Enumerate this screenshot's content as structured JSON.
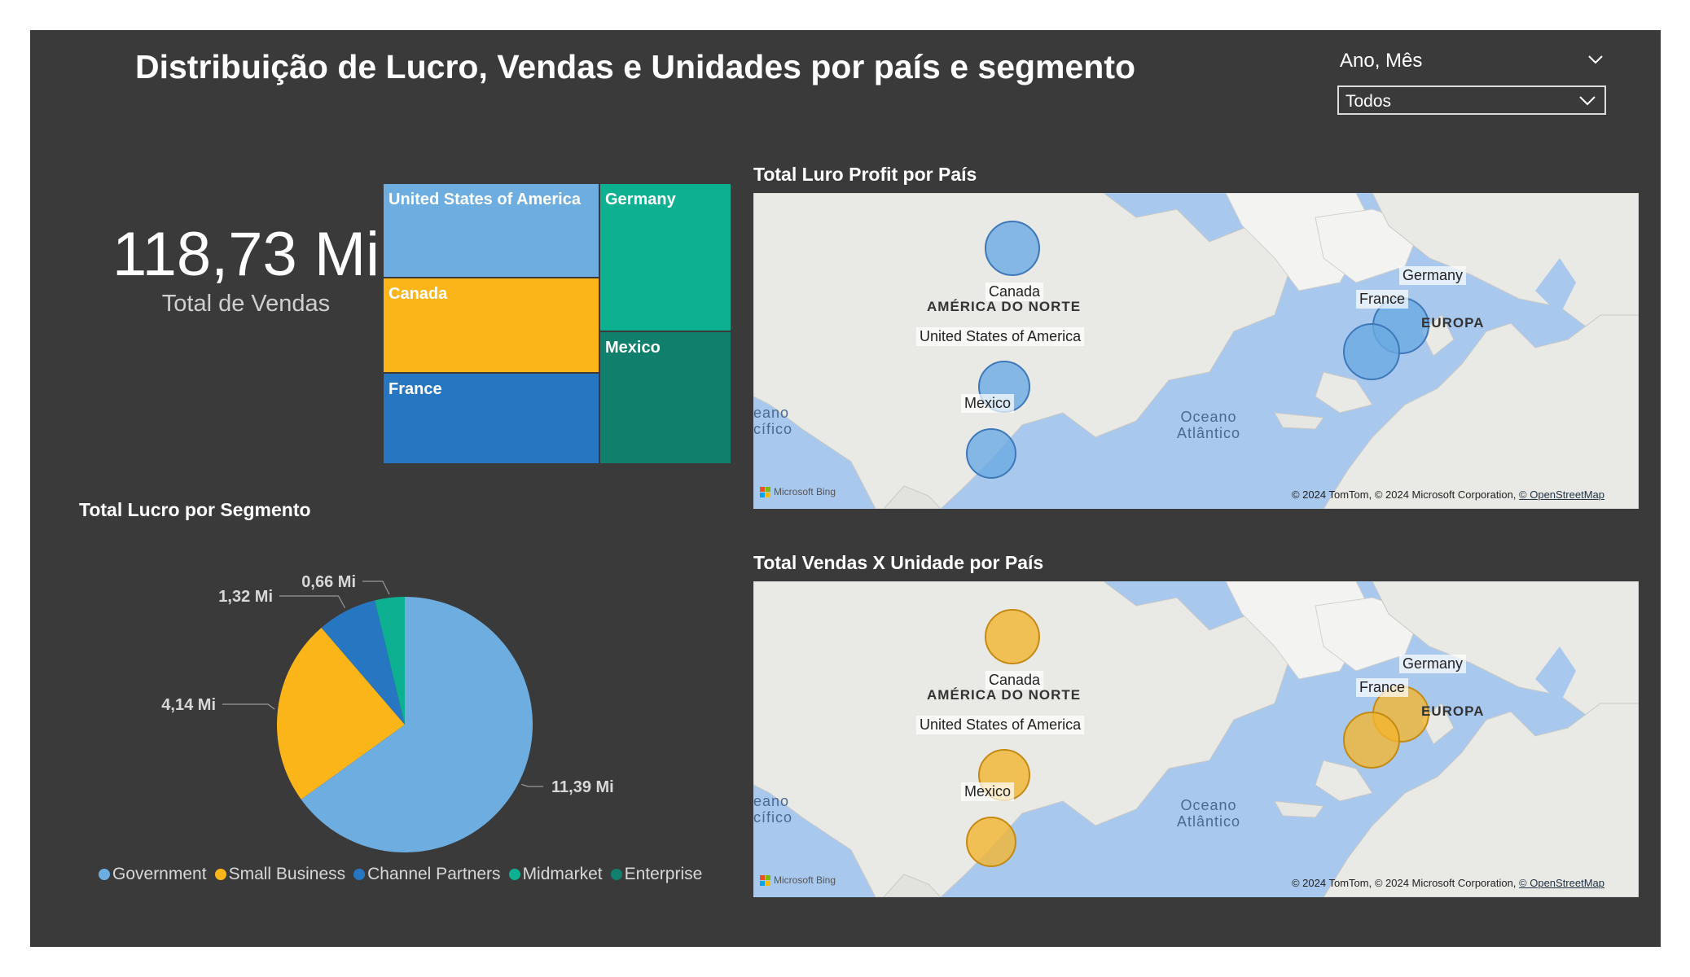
{
  "title": "Distribuição de Lucro, Vendas e Unidades por país e segmento",
  "slicer": {
    "label": "Ano, Mês",
    "value": "Todos"
  },
  "kpi": {
    "value": "118,73 Mi",
    "label": "Total de Vendas"
  },
  "treemap": {
    "tiles": [
      {
        "name": "United States of America",
        "color": "#6daddf"
      },
      {
        "name": "Canada",
        "color": "#fbb519"
      },
      {
        "name": "France",
        "color": "#2776c1"
      },
      {
        "name": "Germany",
        "color": "#0eb092"
      },
      {
        "name": "Mexico",
        "color": "#10806c"
      }
    ]
  },
  "map_profit": {
    "title": "Total Luro Profit por País",
    "bubble_color": "#6aaae2",
    "labels": {
      "canada": "Canada",
      "usa": "United States of America",
      "mexico": "Mexico",
      "germany": "Germany",
      "france": "France"
    },
    "geo": {
      "north_america": "AMÉRICA DO NORTE",
      "europe": "EUROPA",
      "ocean_atlantic": "Oceano\nAtlântico",
      "ocean_pacific": "eano\ncífico"
    },
    "attribution": "© 2024 TomTom, © 2024 Microsoft Corporation,",
    "attribution_link": "© OpenStreetMap",
    "bing": "Microsoft Bing"
  },
  "map_sales": {
    "title": "Total Vendas X Unidade por País",
    "bubble_color": "#f2b531",
    "labels": {
      "canada": "Canada",
      "usa": "United States of America",
      "mexico": "Mexico",
      "germany": "Germany",
      "france": "France"
    },
    "geo": {
      "north_america": "AMÉRICA DO NORTE",
      "europe": "EUROPA",
      "ocean_atlantic": "Oceano\nAtlântico",
      "ocean_pacific": "eano\ncífico"
    },
    "attribution": "© 2024 TomTom, © 2024 Microsoft Corporation,",
    "attribution_link": "© OpenStreetMap",
    "bing": "Microsoft Bing"
  },
  "pie": {
    "title": "Total Lucro por Segmento",
    "legend": [
      "Government",
      "Small Business",
      "Channel Partners",
      "Midmarket",
      "Enterprise"
    ],
    "colors": [
      "#6daddf",
      "#fbb519",
      "#2776c1",
      "#0eb092",
      "#10806c"
    ]
  },
  "chart_data": {
    "type": "pie",
    "title": "Total Lucro por Segmento",
    "categories": [
      "Government",
      "Small Business",
      "Channel Partners",
      "Midmarket",
      "Enterprise"
    ],
    "values": [
      11.39,
      4.14,
      1.32,
      0.66,
      0
    ],
    "data_labels": [
      "11,39 Mi",
      "4,14 Mi",
      "1,32 Mi",
      "0,66 Mi",
      ""
    ],
    "legend_position": "bottom"
  }
}
